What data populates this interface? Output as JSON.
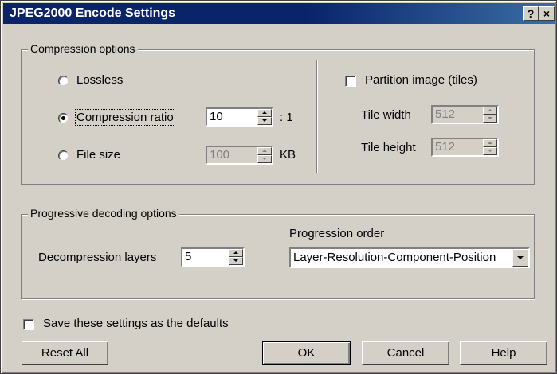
{
  "window": {
    "title": "JPEG2000 Encode Settings",
    "help_btn": "?",
    "close_btn": "×"
  },
  "compression": {
    "group_title": "Compression options",
    "lossless_label": "Lossless",
    "ratio_label": "Compression ratio",
    "ratio_value": "10",
    "ratio_suffix": ": 1",
    "filesize_label": "File size",
    "filesize_value": "100",
    "filesize_unit": "KB",
    "selected": "Compression ratio"
  },
  "tiles": {
    "partition_label": "Partition image (tiles)",
    "partition_checked": false,
    "width_label": "Tile width",
    "width_value": "512",
    "height_label": "Tile height",
    "height_value": "512"
  },
  "progressive": {
    "group_title": "Progressive decoding options",
    "layers_label": "Decompression layers",
    "layers_value": "5",
    "order_label": "Progression order",
    "order_value": "Layer-Resolution-Component-Position"
  },
  "defaults": {
    "save_label": "Save these settings as the defaults",
    "save_checked": false
  },
  "buttons": {
    "reset": "Reset All",
    "ok": "OK",
    "cancel": "Cancel",
    "help": "Help"
  }
}
